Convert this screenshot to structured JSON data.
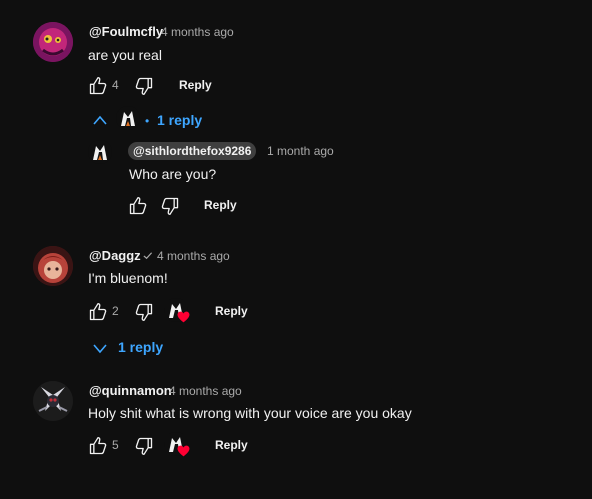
{
  "colors": {
    "background": "#0f0f0f",
    "link": "#3ea6ff",
    "text": "#f1f1f1",
    "muted": "#aaaaaa",
    "heart": "#ff0033"
  },
  "comments": [
    {
      "author": "@Foulmcfly",
      "time": "4 months ago",
      "text": "are you real",
      "likes": "4",
      "reply_label": "Reply",
      "replies_toggle": "1 reply",
      "replies_expanded": true,
      "replies": [
        {
          "author": "@sithlordthefox9286",
          "time": "1 month ago",
          "text": "Who are you?",
          "reply_label": "Reply"
        }
      ]
    },
    {
      "author": "@Daggz",
      "verified_icon": "checkmark-icon",
      "time": "4 months ago",
      "text": "I'm bluenom!",
      "likes": "2",
      "hearted": true,
      "reply_label": "Reply",
      "replies_toggle": "1 reply",
      "replies_expanded": false
    },
    {
      "author": "@quinnamon",
      "time": "4 months ago",
      "text": "Holy shit what is wrong with your voice are you okay",
      "likes": "5",
      "hearted": true,
      "reply_label": "Reply"
    }
  ]
}
